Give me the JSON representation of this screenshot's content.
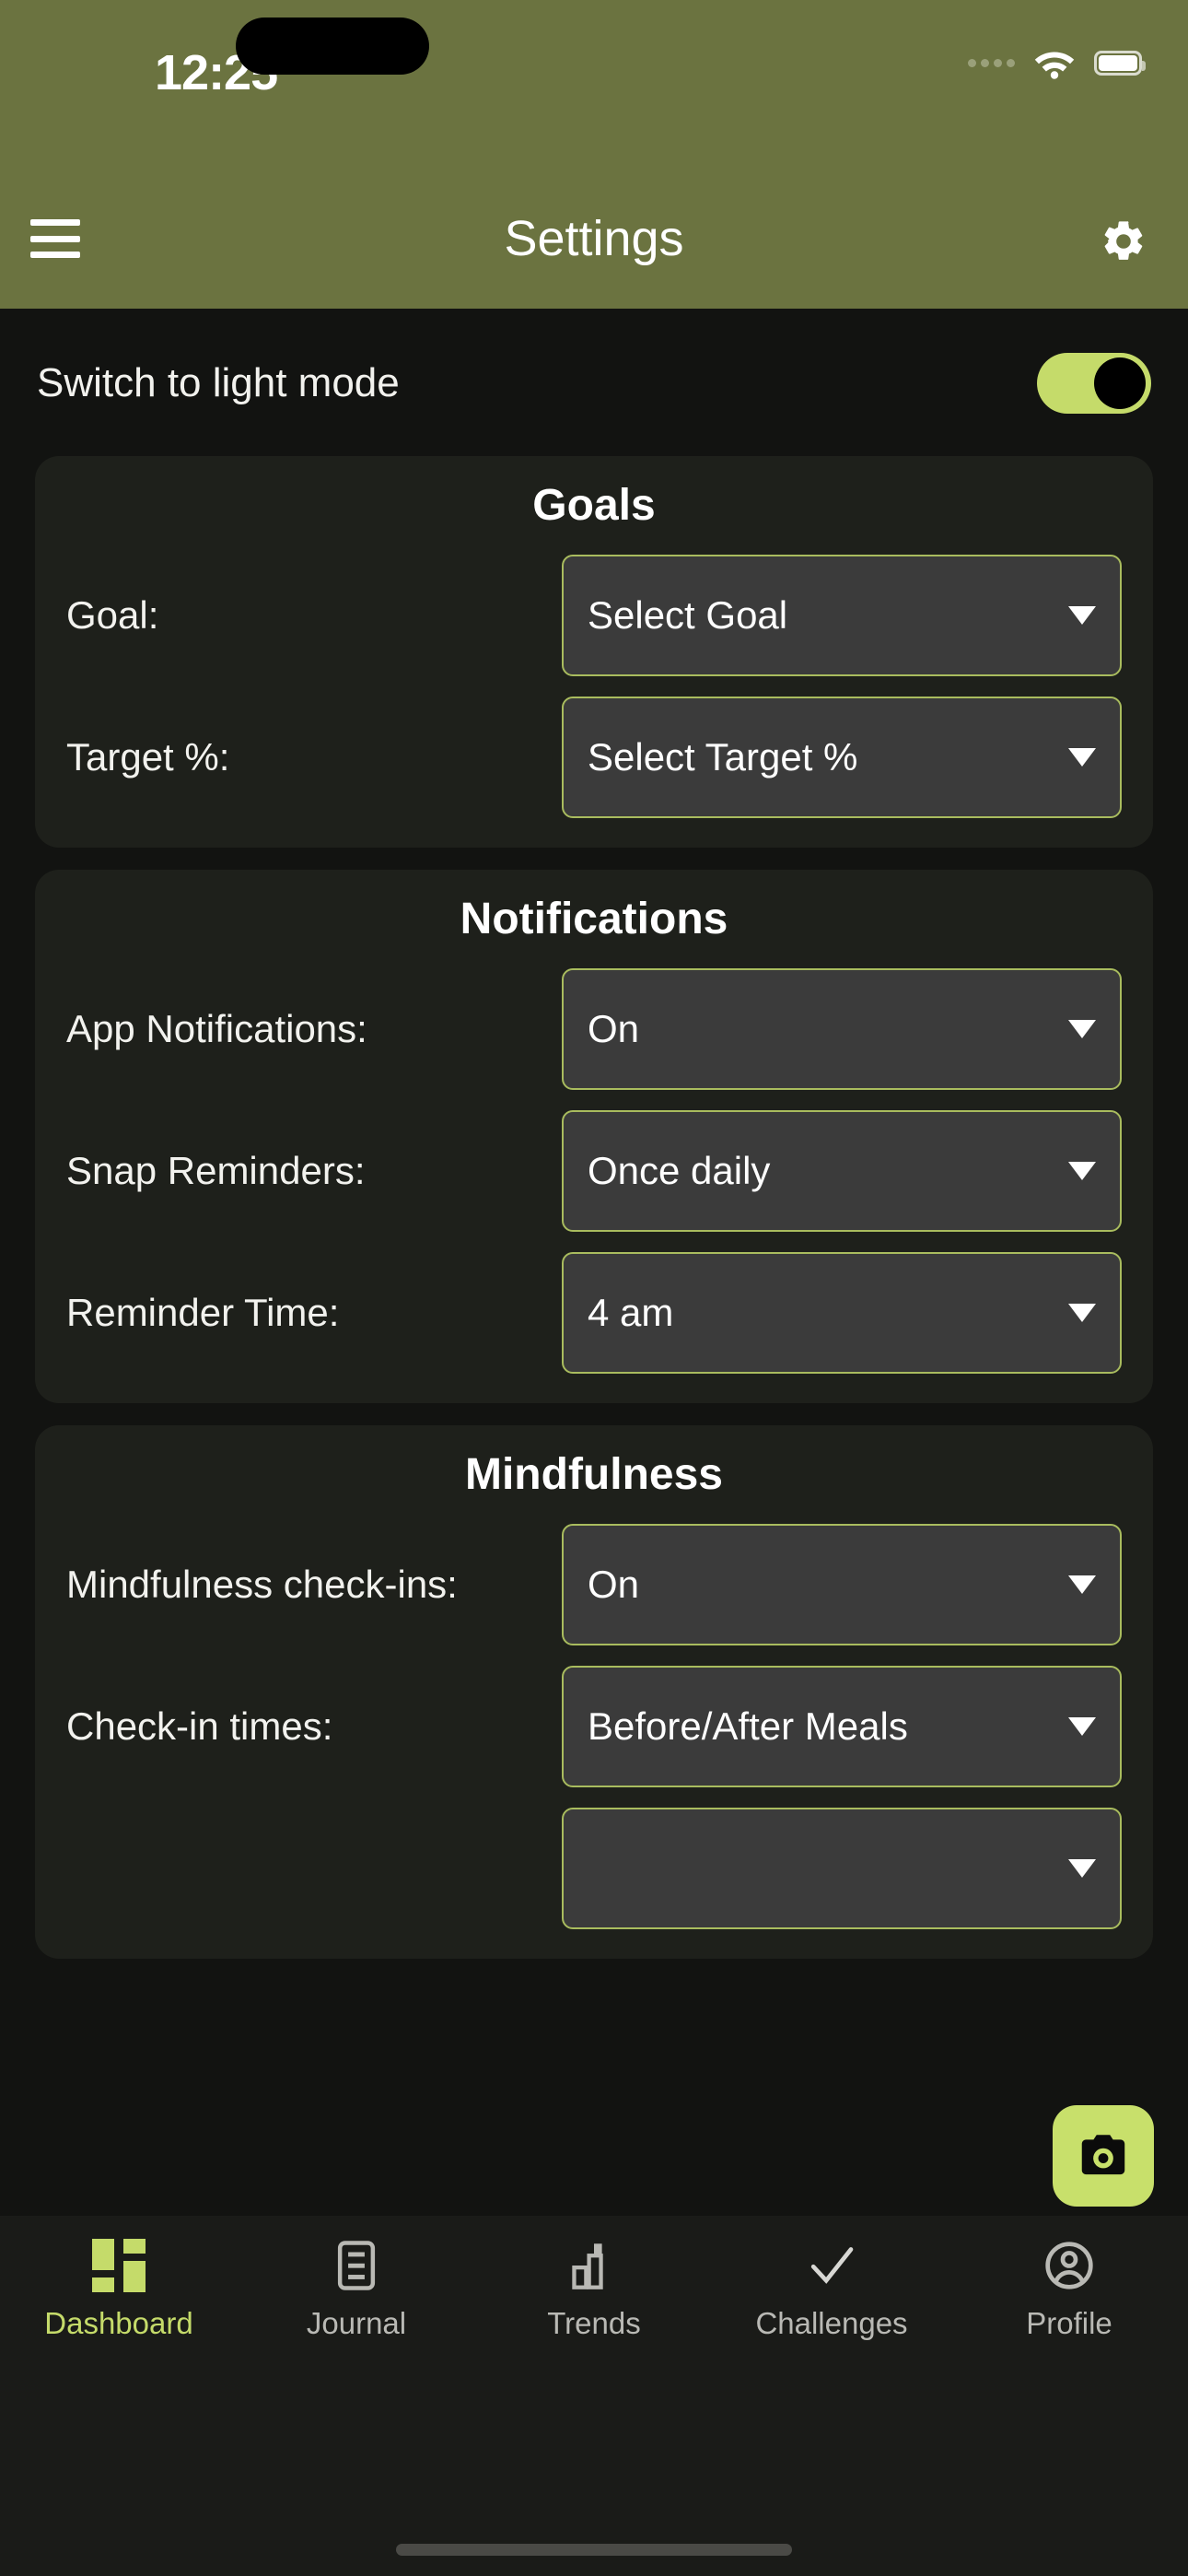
{
  "status_bar": {
    "time": "12:25",
    "signal_icon": "signal-dots-icon",
    "wifi_icon": "wifi-icon",
    "battery_icon": "battery-icon"
  },
  "header": {
    "menu_icon": "hamburger-menu-icon",
    "title": "Settings",
    "settings_icon": "gear-icon"
  },
  "appearance": {
    "label": "Switch to light mode",
    "toggle_state": "on"
  },
  "sections": [
    {
      "title": "Goals",
      "rows": [
        {
          "label": "Goal:",
          "value": "Select Goal"
        },
        {
          "label": "Target %:",
          "value": "Select Target %"
        }
      ]
    },
    {
      "title": "Notifications",
      "rows": [
        {
          "label": "App Notifications:",
          "value": "On"
        },
        {
          "label": "Snap Reminders:",
          "value": "Once daily"
        },
        {
          "label": "Reminder Time:",
          "value": "4 am"
        }
      ]
    },
    {
      "title": "Mindfulness",
      "rows": [
        {
          "label": "Mindfulness check-ins:",
          "value": "On"
        },
        {
          "label": "Check-in times:",
          "value": "Before/After Meals"
        }
      ]
    }
  ],
  "fab": {
    "icon": "camera-icon",
    "label": "Take photo"
  },
  "bottom_nav": {
    "active": "Dashboard",
    "items": [
      {
        "label": "Dashboard",
        "icon": "grid-dashboard-icon"
      },
      {
        "label": "Journal",
        "icon": "notebook-icon"
      },
      {
        "label": "Trends",
        "icon": "bar-chart-icon"
      },
      {
        "label": "Challenges",
        "icon": "check-icon"
      },
      {
        "label": "Profile",
        "icon": "user-circle-icon"
      }
    ]
  },
  "colors": {
    "header_green": "#6B7340",
    "accent_green": "#C5DB6A",
    "page_background": "#121311",
    "card_background": "#1e201b",
    "select_background": "#3b3b3b",
    "select_border": "#A9BC5E"
  }
}
